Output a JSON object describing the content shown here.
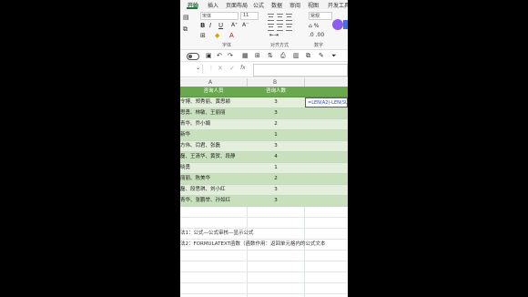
{
  "menu": {
    "tabs": [
      "开始",
      "插入",
      "页面布局",
      "公式",
      "数据",
      "审阅",
      "视图",
      "开发工具"
    ],
    "active": "开始"
  },
  "ribbon": {
    "font_name": "宋体",
    "font_size": "11",
    "number_format": "常规",
    "bold": "B",
    "italic": "I",
    "underline": "U",
    "grow_font": "A⁺",
    "shrink_font": "A⁻",
    "font_color": "A",
    "groups": {
      "font": "字体",
      "alignment": "对齐方式",
      "number": "数字"
    }
  },
  "qat": {
    "icons": [
      "save-icon",
      "undo-icon",
      "redo-icon",
      "print-icon",
      "filter-icon"
    ]
  },
  "columns": {
    "a": "A",
    "b": "B"
  },
  "table": {
    "header": [
      "咨询人员",
      "咨询人数"
    ],
    "rows": [
      {
        "name": "令博、郑秀丽、黄思颖",
        "count": "3",
        "shade": "light"
      },
      {
        "name": "思勇、林敏、王丽丽",
        "count": "3",
        "shade": "dark"
      },
      {
        "name": "青华、乔小娟",
        "count": "2",
        "shade": "light"
      },
      {
        "name": "新华",
        "count": "1",
        "shade": "dark"
      },
      {
        "name": "方伟、闫君、张磊",
        "count": "3",
        "shade": "light"
      },
      {
        "name": "磊、王清华、黄贺、段静",
        "count": "4",
        "shade": "dark"
      },
      {
        "name": "晓勇",
        "count": "1",
        "shade": "light"
      },
      {
        "name": "丽丽、陈美华",
        "count": "2",
        "shade": "dark"
      },
      {
        "name": "磊、段思琪、刘小红",
        "count": "3",
        "shade": "light"
      },
      {
        "name": "青华、张鹏举、孙如红",
        "count": "3",
        "shade": "dark"
      }
    ]
  },
  "formula_text": "=LEN(A2)-LEN(SU",
  "notes": [
    "法1：公式—公式审核—显示公式",
    "法2：FORMULATEXT函数（函数作用：返回单元格内的公式文本"
  ]
}
